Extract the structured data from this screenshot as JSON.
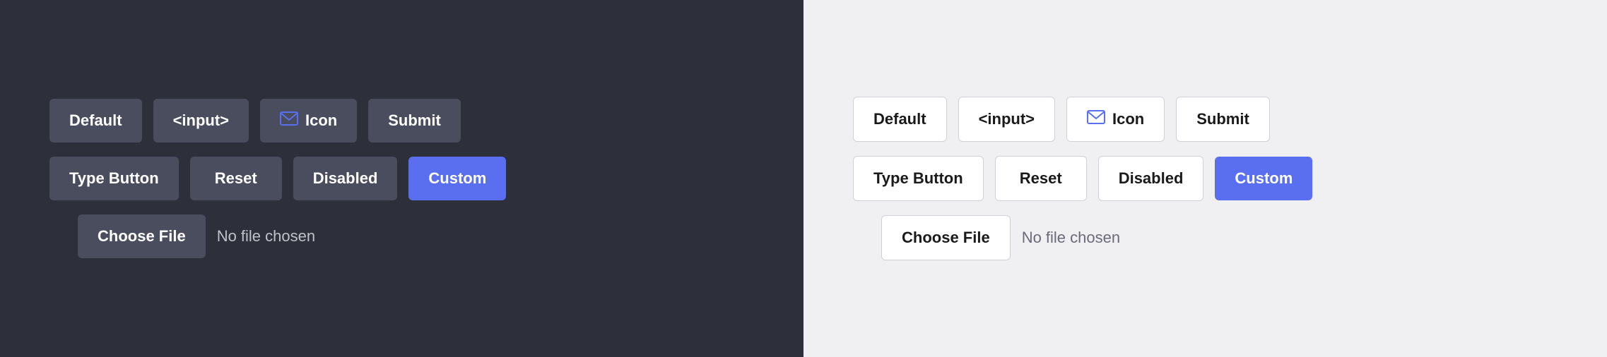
{
  "dark_panel": {
    "row1": [
      {
        "label": "Default",
        "type": "default"
      },
      {
        "label": "<input>",
        "type": "default"
      },
      {
        "label": "Icon",
        "type": "icon"
      },
      {
        "label": "Submit",
        "type": "default"
      }
    ],
    "row2": [
      {
        "label": "Type Button",
        "type": "default"
      },
      {
        "label": "Reset",
        "type": "default"
      },
      {
        "label": "Disabled",
        "type": "default"
      },
      {
        "label": "Custom",
        "type": "custom"
      }
    ],
    "file_button": "Choose File",
    "no_file_text": "No file chosen"
  },
  "light_panel": {
    "row1": [
      {
        "label": "Default",
        "type": "default"
      },
      {
        "label": "<input>",
        "type": "default"
      },
      {
        "label": "Icon",
        "type": "icon"
      },
      {
        "label": "Submit",
        "type": "default"
      }
    ],
    "row2": [
      {
        "label": "Type Button",
        "type": "default"
      },
      {
        "label": "Reset",
        "type": "default"
      },
      {
        "label": "Disabled",
        "type": "default"
      },
      {
        "label": "Custom",
        "type": "custom"
      }
    ],
    "file_button": "Choose File",
    "no_file_text": "No file chosen"
  }
}
